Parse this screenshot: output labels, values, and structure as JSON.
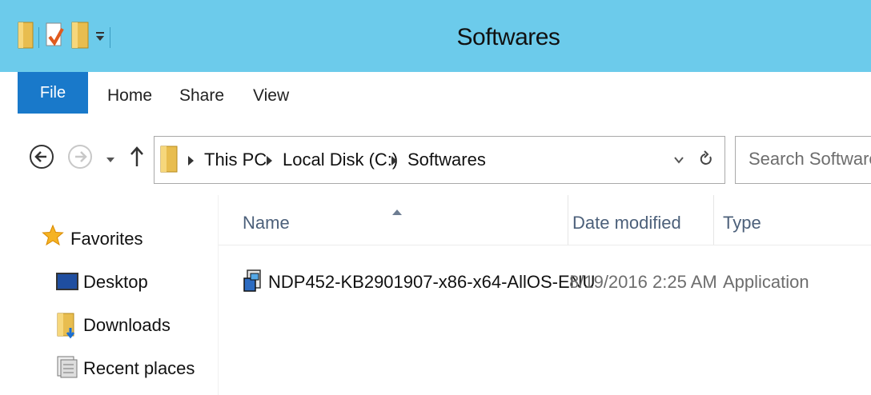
{
  "window": {
    "title": "Softwares"
  },
  "ribbon": {
    "tabs": [
      "File",
      "Home",
      "Share",
      "View"
    ]
  },
  "address": {
    "crumbs": [
      "This PC",
      "Local Disk (C:)",
      "Softwares"
    ]
  },
  "search": {
    "placeholder": "Search Softwares"
  },
  "navpane": {
    "favorites_label": "Favorites",
    "items": [
      {
        "label": "Desktop",
        "icon": "desktop-icon"
      },
      {
        "label": "Downloads",
        "icon": "downloads-folder-icon"
      },
      {
        "label": "Recent places",
        "icon": "recent-places-icon"
      }
    ]
  },
  "columns": {
    "name": "Name",
    "date": "Date modified",
    "type": "Type"
  },
  "files": [
    {
      "name": "NDP452-KB2901907-x86-x64-AllOS-ENU",
      "date": "8/19/2016 2:25 AM",
      "type": "Application",
      "icon": "installer-icon"
    }
  ],
  "colors": {
    "titlebar": "#6ccbeb",
    "file_tab": "#1979ca"
  }
}
